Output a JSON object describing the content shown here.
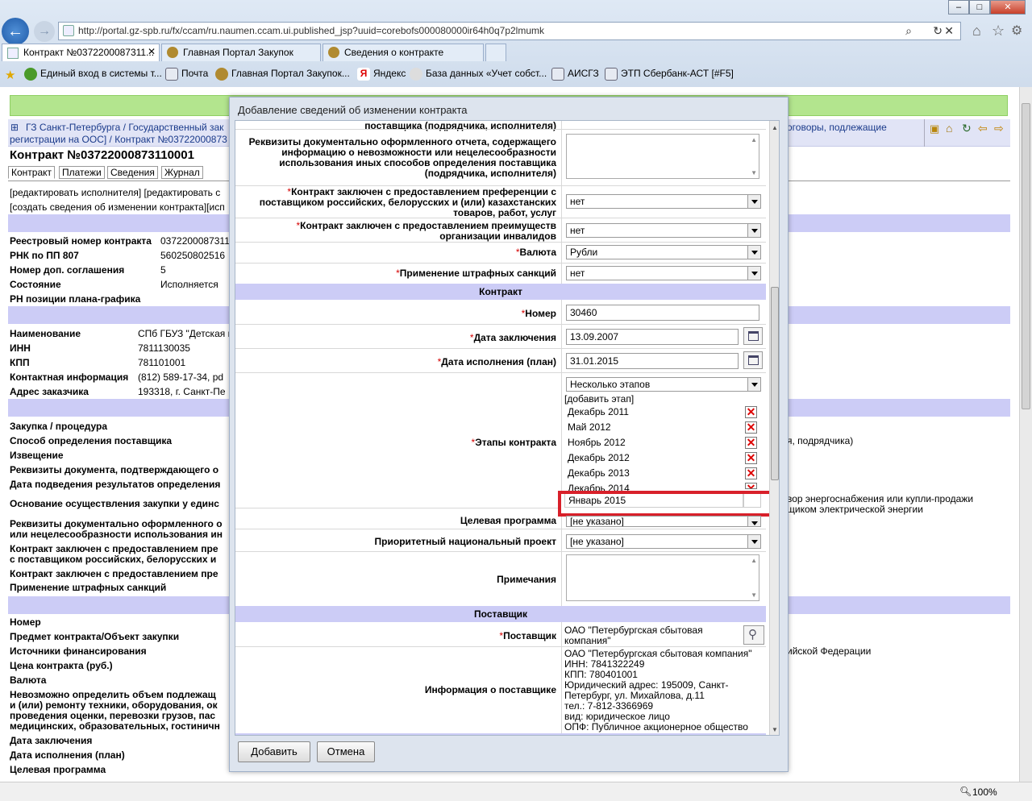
{
  "browser": {
    "url": "http://portal.gz-spb.ru/fx/ccam/ru.naumen.ccam.ui.published_jsp?uuid=corebofs000080000ir64h0q7p2lmumk",
    "tabs": [
      {
        "label": "Контракт №0372200087311..."
      },
      {
        "label": "Главная Портал Закупок"
      },
      {
        "label": "Сведения о контракте"
      }
    ],
    "favorites": [
      {
        "label": "Единый вход в системы т..."
      },
      {
        "label": "Почта"
      },
      {
        "label": "Главная Портал Закупок..."
      },
      {
        "label": "Яндекс"
      },
      {
        "label": "База данных «Учет собст..."
      },
      {
        "label": "АИСГЗ"
      },
      {
        "label": "ЭТП Сбербанк-АСТ [#F5]"
      }
    ],
    "zoom": "100%"
  },
  "page": {
    "breadcrumb_1": "ГЗ Санкт-Петербурга / Государственный зак",
    "breadcrumb_2": "регистрации на ООС] / Контракт №03722000873",
    "breadcrumb_right": "оговоры, подлежащие",
    "title": "Контракт №03722000873110001",
    "subtabs": [
      "Контракт",
      "Платежи",
      "Сведения",
      "Журнал"
    ],
    "links_1": "[редактировать исполнителя] [редактировать с",
    "links_2": "[создать сведения об изменении контракта][исп",
    "fields_a": [
      {
        "label": "Реестровый номер контракта",
        "value": "0372200087311"
      },
      {
        "label": "РНК по ПП 807",
        "value": "560250802516"
      },
      {
        "label": "Номер доп. соглашения",
        "value": "5"
      },
      {
        "label": "Состояние",
        "value": "Исполняется"
      },
      {
        "label": "РН позиции плана-графика",
        "value": ""
      }
    ],
    "fields_b": [
      {
        "label": "Наименование",
        "value": "СПб ГБУЗ \"Детская г"
      },
      {
        "label": "ИНН",
        "value": "7811130035"
      },
      {
        "label": "КПП",
        "value": "781101001"
      },
      {
        "label": "Контактная информация",
        "value": "(812) 589-17-34, pd"
      },
      {
        "label": "Адрес заказчика",
        "value": "193318, г. Санкт-Пе"
      }
    ],
    "fields_c": [
      "Закупка / процедура",
      "Способ определения поставщика",
      "Извещение",
      "Реквизиты документа, подтверждающего о",
      "Дата подведения результатов определения",
      "Основание осуществления закупки у единс",
      "Реквизиты документально оформленного о",
      "или нецелесообразности использования ин",
      "Контракт заключен с предоставлением пре",
      "с поставщиком российских, белорусских и",
      "Контракт заключен с предоставлением пре",
      "Применение штрафных санкций"
    ],
    "right_texts": {
      "supplier_method": "я, подрядчика)",
      "basis_1": "вор энергоснабжения или купли-продажи",
      "basis_2": "щиком электрической энергии",
      "finance": "ийской Федерации"
    },
    "fields_d": [
      "Номер",
      "Предмет контракта/Объект закупки",
      "Источники финансирования",
      "Цена контракта (руб.)",
      "Валюта",
      "Невозможно определить объем подлежащ",
      "и (или) ремонту техники, оборудования, ок",
      "проведения оценки, перевозки грузов, пас",
      "медицинских, образовательных, гостиничн",
      "Дата заключения",
      "Дата исполнения (план)",
      "Целевая программа"
    ]
  },
  "dialog": {
    "title": "Добавление сведений об изменении контракта",
    "top_cut_label": "поставщика (подрядчика, исполнителя)",
    "report_label": "Реквизиты документально оформленного отчета, содержащего информацию о невозможности или нецелесообразности использования иных способов определения поставщика (подрядчика, исполнителя)",
    "preference_label": "Контракт заключен с предоставлением преференции с поставщиком российских, белорусских и (или) казахстанских товаров, работ, услуг",
    "preference_value": "нет",
    "disabled_label": "Контракт заключен с предоставлением преимуществ организации инвалидов",
    "disabled_value": "нет",
    "currency_label": "Валюта",
    "currency_value": "Рубли",
    "penalty_label": "Применение штрафных санкций",
    "penalty_value": "нет",
    "contract_section": "Контракт",
    "number_label": "Номер",
    "number_value": "30460",
    "date_label": "Дата заключения",
    "date_value": "13.09.2007",
    "plan_label": "Дата исполнения (план)",
    "plan_value": "31.01.2015",
    "stages_label": "Этапы контракта",
    "stages_mode": "Несколько этапов",
    "add_stage": "[добавить этап]",
    "stages": [
      "Декабрь 2011",
      "Май 2012",
      "Ноябрь 2012",
      "Декабрь 2012",
      "Декабрь 2013",
      "Декабрь 2014"
    ],
    "new_stage": "Январь 2015",
    "program_label": "Целевая программа",
    "program_value": "[не указано]",
    "priority_label": "Приоритетный национальный проект",
    "priority_value": "[не указано]",
    "notes_label": "Примечания",
    "supplier_section": "Поставщик",
    "supplier_label": "Поставщик",
    "supplier_value_1": "ОАО \"Петербургская сбытовая",
    "supplier_value_2": "компания\"",
    "supplier_info_label": "Информация о поставщике",
    "supplier_info": [
      "ОАО \"Петербургская сбытовая компания\"",
      "ИНН: 7841322249",
      "КПП: 780401001",
      "Юридический адрес: 195009, Санкт-",
      "Петербург, ул. Михайлова, д.11",
      "тел.: 7-812-3366969",
      "вид: юридическое лицо",
      "ОПФ: Публичное акционерное общество"
    ],
    "add_button": "Добавить",
    "cancel_button": "Отмена"
  },
  "colors": {
    "highlight": "#d8202a",
    "section_band": "#ccccf6",
    "green_bar": "#b3e58e"
  }
}
